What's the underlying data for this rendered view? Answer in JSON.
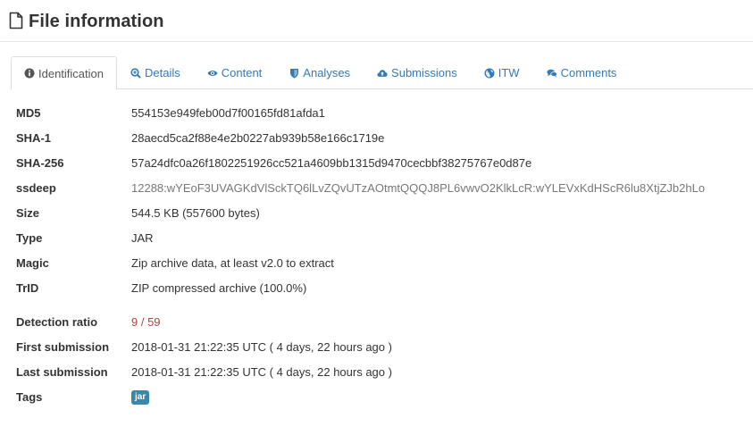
{
  "header": {
    "title": "File information",
    "icon": "file-icon"
  },
  "tabs": [
    {
      "label": "Identification",
      "icon": "info-circle-icon",
      "active": true
    },
    {
      "label": "Details",
      "icon": "zoom-icon",
      "active": false
    },
    {
      "label": "Content",
      "icon": "eye-icon",
      "active": false
    },
    {
      "label": "Analyses",
      "icon": "shield-icon",
      "active": false
    },
    {
      "label": "Submissions",
      "icon": "cloud-upload-icon",
      "active": false
    },
    {
      "label": "ITW",
      "icon": "globe-icon",
      "active": false
    },
    {
      "label": "Comments",
      "icon": "comments-icon",
      "active": false
    }
  ],
  "info": {
    "md5": {
      "label": "MD5",
      "value": "554153e949feb00d7f00165fd81afda1"
    },
    "sha1": {
      "label": "SHA-1",
      "value": "28aecd5ca2f88e4e2b0227ab939b58e166c1719e"
    },
    "sha256": {
      "label": "SHA-256",
      "value": "57a24dfc0a26f1802251926cc521a4609bb1315d9470cecbbf38275767e0d87e"
    },
    "ssdeep": {
      "label": "ssdeep",
      "value": "12288:wYEoF3UVAGKdVlSckTQ6lLvZQvUTzAOtmtQQQJ8PL6vwvO2KlkLcR:wYLEVxKdHScR6lu8XtjZJb2hLo"
    },
    "size": {
      "label": "Size",
      "value": "544.5 KB (557600 bytes)"
    },
    "type": {
      "label": "Type",
      "value": "JAR"
    },
    "magic": {
      "label": "Magic",
      "value": "Zip archive data, at least v2.0 to extract"
    },
    "trid": {
      "label": "TrID",
      "value": "ZIP compressed archive (100.0%)"
    },
    "detection": {
      "label": "Detection ratio",
      "value": "9 / 59"
    },
    "first_submission": {
      "label": "First submission",
      "value": "2018-01-31 21:22:35 UTC ( 4 days, 22 hours ago )"
    },
    "last_submission": {
      "label": "Last submission",
      "value": "2018-01-31 21:22:35 UTC ( 4 days, 22 hours ago )"
    },
    "tags": {
      "label": "Tags",
      "items": [
        "jar"
      ]
    }
  },
  "colors": {
    "link": "#337ab7",
    "detection": "#a94442",
    "tag": "#3a87ad",
    "muted": "#777777"
  }
}
